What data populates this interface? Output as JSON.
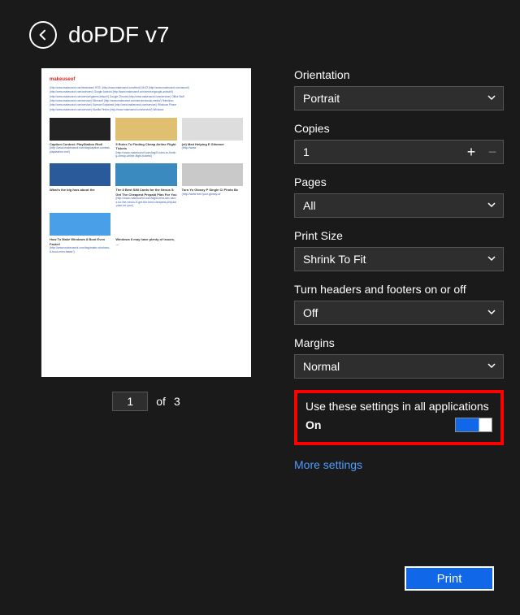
{
  "header": {
    "title": "doPDF v7"
  },
  "preview": {
    "logo_prefix": "make",
    "logo_accent": "use",
    "logo_suffix": "of",
    "links": [
      "(http://www.makeuseof.com/feed/atom) RSS  (http://www.makeuseof.com/feed/) MUO (http://www.makeuseof.com/about/)",
      "(http://www.makeuseof.com/archives/) Google Android (http://www.makeuseof.com/service/google-android/)",
      "(http://www.makeuseof.com/service/games-leisure/) Google Chrome (http://www.makeuseof.com/service/) Office Stuff",
      "(http://www.makeuseof.com/service/) Microsoft (http://www.makeuseof.com/service/social-media/) Television",
      "(http://www.makeuseof.com/service/) Science Explained (http://www.makeuseof.com/service/) Windows Phone",
      "(http://www.makeuseof.com/service/) Mozilla Firefox (http://www.makeuseof.com/service/) Windows"
    ],
    "cards": {
      "row1": [
        {
          "title": "Caption Contest: PlayStation Riot!",
          "link": "(http://www.makeuseof.com/tag/caption-contest-playstation-riot/)",
          "color": "#222"
        },
        {
          "title": "5 Rules To Finding Cheap Airline Flight Tickets",
          "link": "(http://www.makeuseof.com/tag/5-rules-to-finding-cheap-airline-flight-tickets/)",
          "color": "#e0c070"
        },
        {
          "title": "(et) Med Helping E Glimmer",
          "link": "(http://www",
          "color": "#ddd"
        }
      ],
      "row2": [
        {
          "title": "What's the big fuss about the",
          "link": "",
          "color": "#2a5a9a"
        },
        {
          "title": "The 8 Best SIM Cards for the Nexus 5: Get The Cheapest Prepaid Plan For You",
          "link": "(http://www.makeuseof.com/tag/8-best-sim-cards-for-the-nexus-5-get-the-best-cheapest-prepaid-plan-for-you/)",
          "color": "#3a8ac0"
        },
        {
          "title": "Turn Yo Glossy P Single Cl Photo Bc",
          "link": "(http://www turn-your-glossy-of",
          "color": "#c9c9c9"
        }
      ],
      "row3": [
        {
          "title": "How To Make Windows 8 Boot Even Faster!",
          "link": "(http://www.makeuseof.com/tag/make-windows-8-boot-even-faster/)",
          "color": "#4aa0e8"
        },
        {
          "title": "Windows 8 may have plenty of issues, …",
          "link": "",
          "color": "#fff"
        },
        {
          "title": "",
          "link": "",
          "color": "#fff"
        }
      ]
    }
  },
  "pager": {
    "current": "1",
    "of_label": "of",
    "total": "3"
  },
  "settings": {
    "orientation": {
      "label": "Orientation",
      "value": "Portrait"
    },
    "copies": {
      "label": "Copies",
      "value": "1"
    },
    "pages": {
      "label": "Pages",
      "value": "All"
    },
    "print_size": {
      "label": "Print Size",
      "value": "Shrink To Fit"
    },
    "headers_footers": {
      "label": "Turn headers and footers on or off",
      "value": "Off"
    },
    "margins": {
      "label": "Margins",
      "value": "Normal"
    },
    "use_all_apps": {
      "label": "Use these settings in all applications",
      "state": "On"
    },
    "more_link": "More settings"
  },
  "footer": {
    "print_label": "Print"
  }
}
